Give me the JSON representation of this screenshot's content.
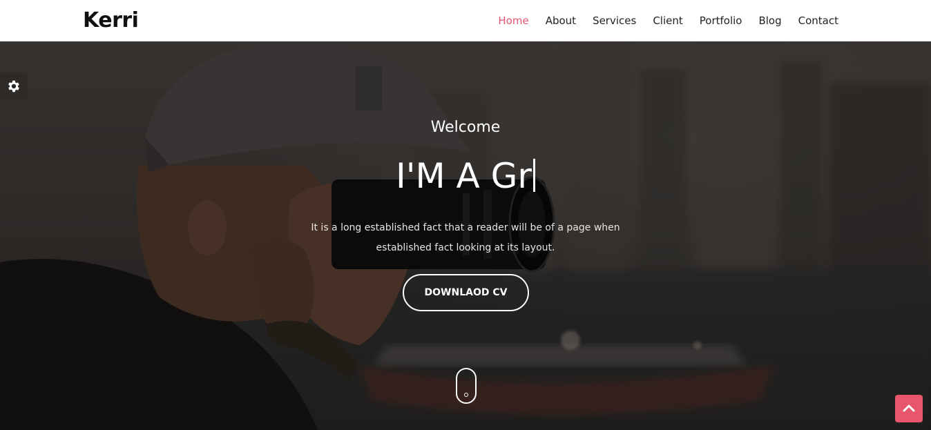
{
  "brand": {
    "logo_text": "Kerri"
  },
  "nav": {
    "items": [
      {
        "label": "Home",
        "active": true
      },
      {
        "label": "About",
        "active": false
      },
      {
        "label": "Services",
        "active": false
      },
      {
        "label": "Client",
        "active": false
      },
      {
        "label": "Portfolio",
        "active": false
      },
      {
        "label": "Blog",
        "active": false
      },
      {
        "label": "Contact",
        "active": false
      }
    ]
  },
  "hero": {
    "welcome": "Welcome",
    "headline": "I'M A Gr",
    "description_line1": "It is a long established fact that a reader will be of a page when",
    "description_line2": "established fact looking at its layout.",
    "cta_label": "DOWNLAOD CV"
  },
  "icons": {
    "settings": "gear-icon",
    "back_to_top": "chevron-up-icon",
    "scroll": "mouse-scroll-icon"
  },
  "colors": {
    "accent": "#e8566b",
    "nav_active": "#e0566e",
    "nav_text": "#222222",
    "hero_overlay": "#000000"
  }
}
